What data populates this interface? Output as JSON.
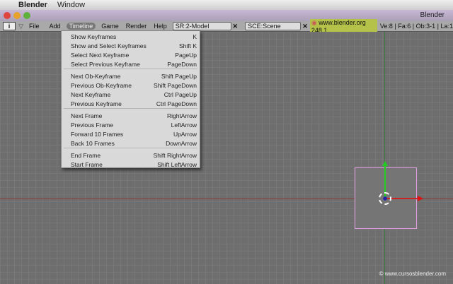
{
  "macbar": {
    "app": "Blender",
    "menu": "Window"
  },
  "window": {
    "title": "Blender"
  },
  "header": {
    "menus": [
      "File",
      "Add",
      "Timeline",
      "Game",
      "Render",
      "Help"
    ],
    "screen": "SR:2-Model",
    "scene": "SCE:Scene",
    "version": "www.blender.org 248.1",
    "stats": "Ve:8 | Fa:6 | Ob:3-1 | La:1"
  },
  "menu": {
    "items": [
      {
        "label": "Show Keyframes",
        "shortcut": "K"
      },
      {
        "label": "Show and Select Keyframes",
        "shortcut": "Shift K"
      },
      {
        "label": "Select Next Keyframe",
        "shortcut": "PageUp"
      },
      {
        "label": "Select Previous Keyframe",
        "shortcut": "PageDown"
      },
      {
        "label": "Next Ob-Keyframe",
        "shortcut": "Shift PageUp"
      },
      {
        "label": "Previous Ob-Keyframe",
        "shortcut": "Shift PageDown"
      },
      {
        "label": "Next Keyframe",
        "shortcut": "Ctrl PageUp"
      },
      {
        "label": "Previous Keyframe",
        "shortcut": "Ctrl PageDown"
      },
      {
        "label": "Next Frame",
        "shortcut": "RightArrow"
      },
      {
        "label": "Previous Frame",
        "shortcut": "LeftArrow"
      },
      {
        "label": "Forward 10 Frames",
        "shortcut": "UpArrow"
      },
      {
        "label": "Back 10 Frames",
        "shortcut": "DownArrow"
      },
      {
        "label": "End Frame",
        "shortcut": "Shift RightArrow"
      },
      {
        "label": "Start Frame",
        "shortcut": "Shift LeftArrow"
      }
    ]
  },
  "watermark": "© www.cursosblender.com"
}
